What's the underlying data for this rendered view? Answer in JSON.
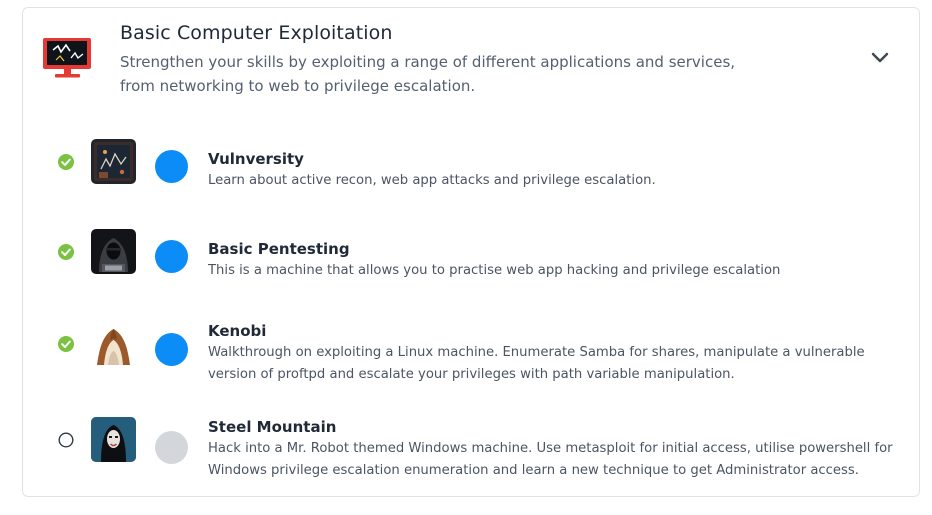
{
  "module": {
    "title": "Basic Computer Exploitation",
    "description": "Strengthen your skills by exploiting a range of different applications and services, from networking to web to privilege escalation.",
    "icon": "monitor-hacked-icon",
    "expand_icon": "chevron-down-icon"
  },
  "colors": {
    "complete": "#7bc142",
    "progress_active": "#0b8cf6",
    "progress_inactive": "#d3d6da"
  },
  "rooms": [
    {
      "title": "Vulnversity",
      "description": "Learn about active recon, web app attacks and privilege escalation.",
      "completed": true,
      "icon": "vulnversity-room-icon"
    },
    {
      "title": "Basic Pentesting",
      "description": "This is a machine that allows you to practise web app hacking and privilege escalation",
      "completed": true,
      "icon": "hooded-hacker-icon"
    },
    {
      "title": "Kenobi",
      "description": "Walkthrough on exploiting a Linux machine. Enumerate Samba for shares, manipulate a vulnerable version of proftpd and escalate your privileges with path variable manipulation.",
      "completed": true,
      "icon": "hooded-jedi-icon"
    },
    {
      "title": "Steel Mountain",
      "description": "Hack into a Mr. Robot themed Windows machine. Use metasploit for initial access, utilise powershell for Windows privilege escalation enumeration and learn a new technique to get Administrator access.",
      "completed": false,
      "icon": "mr-robot-icon"
    }
  ]
}
